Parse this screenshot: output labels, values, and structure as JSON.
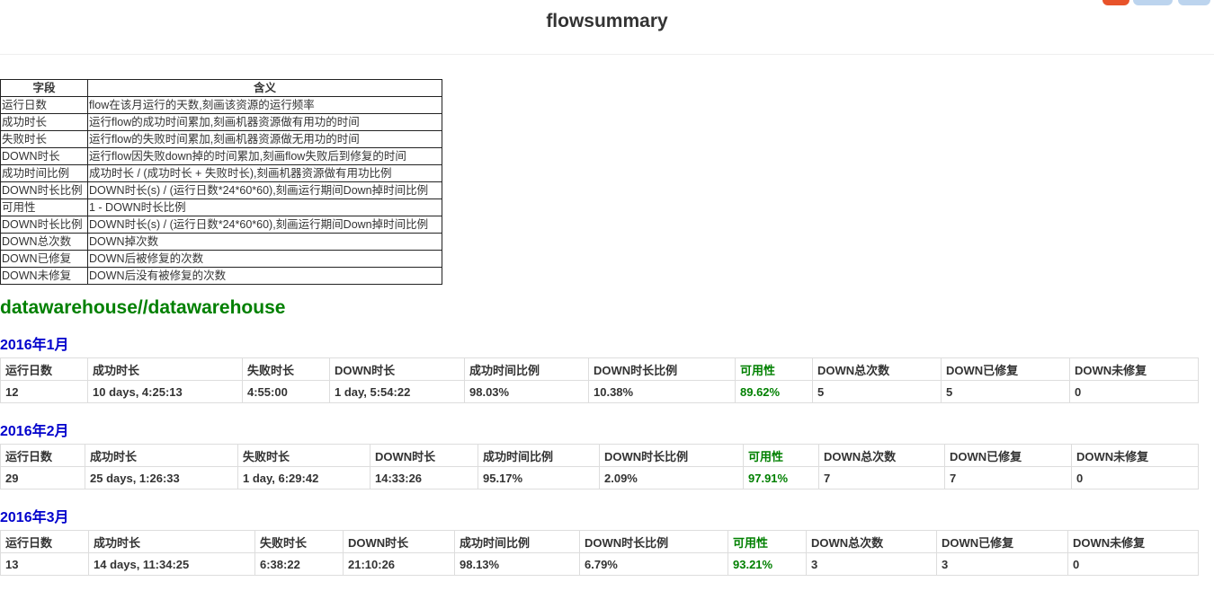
{
  "page": {
    "title": "flowsummary"
  },
  "colors": {
    "section": "#008000",
    "month": "#0000cc",
    "highlight": "#008000"
  },
  "legend": {
    "headers": [
      "字段",
      "含义"
    ],
    "rows": [
      [
        "运行日数",
        "flow在该月运行的天数,刻画该资源的运行频率"
      ],
      [
        "成功时长",
        "运行flow的成功时间累加,刻画机器资源做有用功的时间"
      ],
      [
        "失败时长",
        "运行flow的失败时间累加,刻画机器资源做无用功的时间"
      ],
      [
        "DOWN时长",
        "运行flow因失败down掉的时间累加,刻画flow失败后到修复的时间"
      ],
      [
        "成功时间比例",
        "成功时长 / (成功时长 + 失败时长),刻画机器资源做有用功比例"
      ],
      [
        "DOWN时长比例",
        "DOWN时长(s) / (运行日数*24*60*60),刻画运行期间Down掉时间比例"
      ],
      [
        "可用性",
        "1 - DOWN时长比例"
      ],
      [
        "DOWN时长比例",
        "DOWN时长(s) / (运行日数*24*60*60),刻画运行期间Down掉时间比例"
      ],
      [
        "DOWN总次数",
        "DOWN掉次数"
      ],
      [
        "DOWN已修复",
        "DOWN后被修复的次数"
      ],
      [
        "DOWN未修复",
        "DOWN后没有被修复的次数"
      ]
    ]
  },
  "section": {
    "title": "datawarehouse//datawarehouse"
  },
  "months": [
    {
      "label": "2016年1月",
      "headers": [
        "运行日数",
        "成功时长",
        "失败时长",
        "DOWN时长",
        "成功时间比例",
        "DOWN时长比例",
        "可用性",
        "DOWN总次数",
        "DOWN已修复",
        "DOWN未修复"
      ],
      "values": [
        "12",
        "10 days, 4:25:13",
        "4:55:00",
        "1 day, 5:54:22",
        "98.03%",
        "10.38%",
        "89.62%",
        "5",
        "5",
        "0"
      ]
    },
    {
      "label": "2016年2月",
      "headers": [
        "运行日数",
        "成功时长",
        "失败时长",
        "DOWN时长",
        "成功时间比例",
        "DOWN时长比例",
        "可用性",
        "DOWN总次数",
        "DOWN已修复",
        "DOWN未修复"
      ],
      "values": [
        "29",
        "25 days, 1:26:33",
        "1 day, 6:29:42",
        "14:33:26",
        "95.17%",
        "2.09%",
        "97.91%",
        "7",
        "7",
        "0"
      ]
    },
    {
      "label": "2016年3月",
      "headers": [
        "运行日数",
        "成功时长",
        "失败时长",
        "DOWN时长",
        "成功时间比例",
        "DOWN时长比例",
        "可用性",
        "DOWN总次数",
        "DOWN已修复",
        "DOWN未修复"
      ],
      "values": [
        "13",
        "14 days, 11:34:25",
        "6:38:22",
        "21:10:26",
        "98.13%",
        "6.79%",
        "93.21%",
        "3",
        "3",
        "0"
      ]
    }
  ]
}
